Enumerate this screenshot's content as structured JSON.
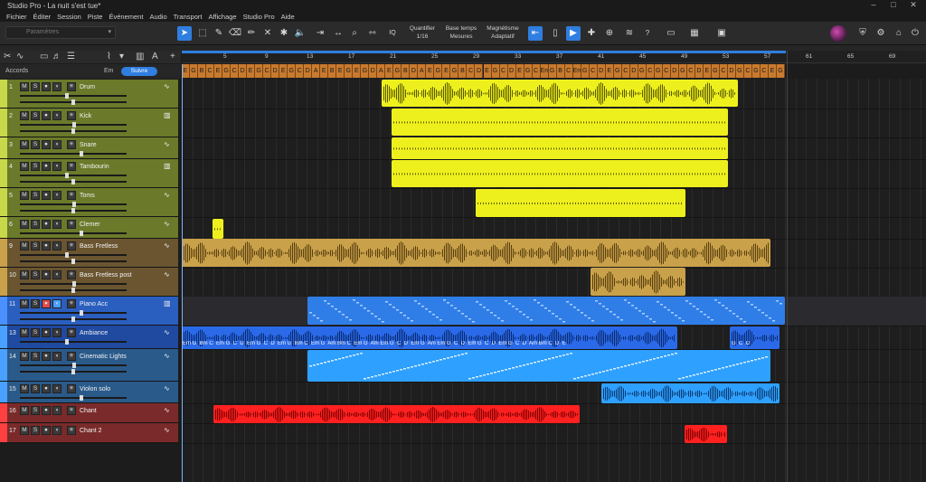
{
  "window": {
    "title": "Studio Pro - La nuit s'est tue*",
    "minimize": "–",
    "maximize": "□",
    "close": "✕"
  },
  "menu": [
    "Fichier",
    "Éditer",
    "Session",
    "Piste",
    "Événement",
    "Audio",
    "Transport",
    "Affichage",
    "Studio Pro",
    "Aide"
  ],
  "toolbar": {
    "preset_placeholder": "Paramètres",
    "quantize_label": "Quantifier",
    "quantize_value": "1/16",
    "timebase_label": "Base temps",
    "timebase_value": "Mesures",
    "snap_label": "Magnétisme",
    "snap_value": "Adaptatif",
    "iq": "IQ",
    "help": "?"
  },
  "chords_lane": {
    "label": "Accords",
    "key": "Em",
    "follow_label": "Suivre"
  },
  "ruler_marks": [
    "5",
    "9",
    "13",
    "17",
    "21",
    "25",
    "29",
    "33",
    "37",
    "41",
    "45",
    "49",
    "53",
    "57",
    "61",
    "65",
    "69"
  ],
  "chords": [
    "E",
    "G",
    "B",
    "C",
    "E",
    "G",
    "C",
    "D",
    "E",
    "G",
    "C",
    "D",
    "E",
    "G",
    "C",
    "D",
    "A",
    "E",
    "B",
    "E",
    "G",
    "E",
    "G",
    "D",
    "A",
    "E",
    "G",
    "B",
    "D",
    "A",
    "E",
    "G",
    "E",
    "G",
    "B",
    "C",
    "D",
    "E",
    "G",
    "C",
    "D",
    "E",
    "G",
    "C",
    "Em",
    "G",
    "B",
    "C",
    "Em",
    "G",
    "C",
    "D",
    "E",
    "G",
    "C",
    "D",
    "G",
    "C",
    "G",
    "C",
    "D",
    "G",
    "C",
    "D",
    "E",
    "G",
    "C",
    "D",
    "G",
    "C",
    "G",
    "C",
    "E",
    "G"
  ],
  "tracks": [
    {
      "num": "1",
      "name": "Drum",
      "color": "#6a7a2a"
    },
    {
      "num": "2",
      "name": "Kick",
      "color": "#6a7a2a"
    },
    {
      "num": "3",
      "name": "Snare",
      "color": "#6a7a2a"
    },
    {
      "num": "4",
      "name": "Tambourin",
      "color": "#6a7a2a"
    },
    {
      "num": "5",
      "name": "Toms",
      "color": "#6a7a2a"
    },
    {
      "num": "6",
      "name": "Clemer",
      "color": "#6a7a2a"
    },
    {
      "num": "9",
      "name": "Bass Fretless",
      "color": "#6a5530"
    },
    {
      "num": "10",
      "name": "Bass Fretless post",
      "color": "#6a5530"
    },
    {
      "num": "11",
      "name": "Piano Acc",
      "color": "#2a5fbf"
    },
    {
      "num": "13",
      "name": "Ambiance",
      "color": "#1f4aa0"
    },
    {
      "num": "14",
      "name": "Cinematic Lights",
      "color": "#2a5a8a"
    },
    {
      "num": "15",
      "name": "Violon solo",
      "color": "#2a5a8a"
    },
    {
      "num": "16",
      "name": "Chant",
      "color": "#7a2a2a"
    },
    {
      "num": "17",
      "name": "Chant 2",
      "color": "#7a2a2a"
    }
  ],
  "ambiance_chords": "Em G  Bm C  Em G  C  D  Em G  C  D  Em G  Bm C  Em G  Am Bm C  Em G  Am Em G  C  D  Em G  Am Em G  C  D  Em G  C  D  Em G  C  D  Am Bm C  D  E",
  "ambiance_chords_end": "G  C  D",
  "colors": {
    "accent": "#2f7ee0",
    "drums": "#eef01e",
    "bass": "#c9a14a",
    "piano": "#2f7ee8",
    "strings": "#2ea0ff",
    "vocals": "#ff2020"
  }
}
